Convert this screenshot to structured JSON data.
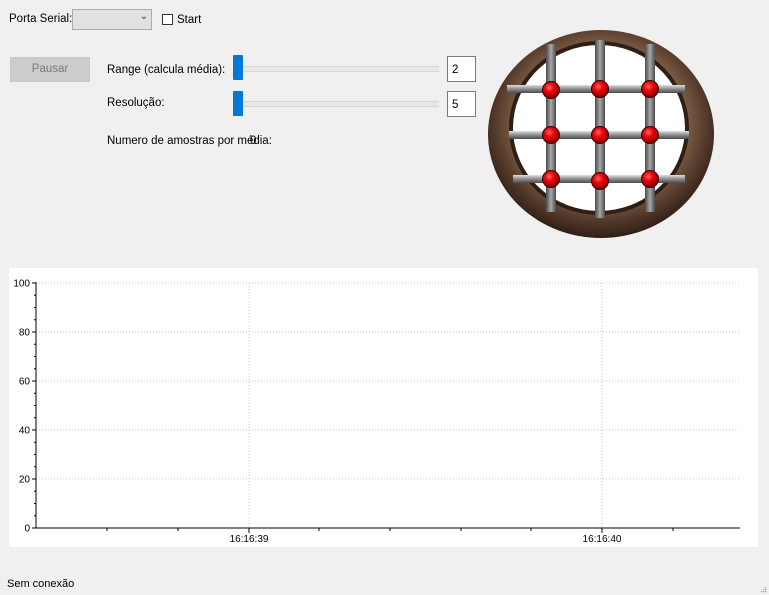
{
  "toolbar": {
    "port_label": "Porta Serial:",
    "port_value": "",
    "start_label": "Start",
    "start_checked": false
  },
  "controls": {
    "pause_label": "Pausar",
    "range": {
      "label": "Range (calcula média):",
      "value": "2"
    },
    "resolution": {
      "label": "Resolução:",
      "value": "5"
    },
    "samples": {
      "label": "Numero de amostras por média:",
      "value": "0"
    }
  },
  "chart_data": {
    "type": "line",
    "title": "",
    "xlabel": "",
    "ylabel": "",
    "ylim": [
      0,
      100
    ],
    "yticks": [
      "0",
      "20",
      "40",
      "60",
      "80",
      "100"
    ],
    "xticks": [
      "16:16:39",
      "16:16:40"
    ],
    "grid": true,
    "series": []
  },
  "status": {
    "text": "Sem conexão"
  },
  "colors": {
    "accent": "#0078d7",
    "sensor_dot": "#e8000a",
    "frame": "#5a3e2b"
  }
}
